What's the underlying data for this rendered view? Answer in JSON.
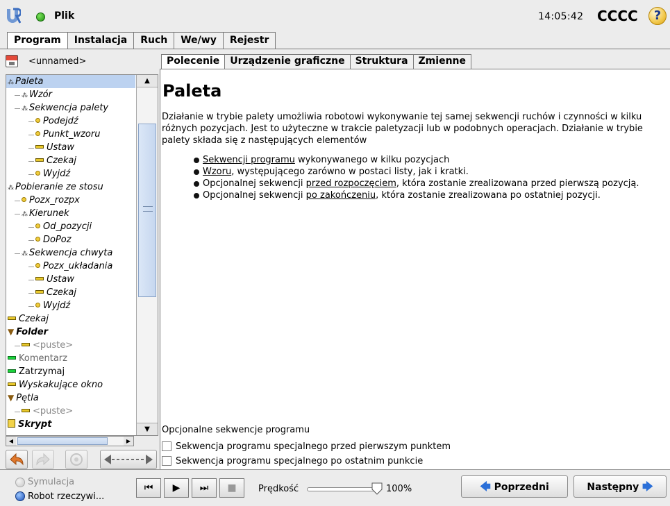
{
  "titlebar": {
    "file_menu": "Plik",
    "clock": "14:05:42",
    "robot_name": "CCCC",
    "help": "?"
  },
  "top_tabs": [
    {
      "label": "Program",
      "active": true
    },
    {
      "label": "Instalacja",
      "active": false
    },
    {
      "label": "Ruch",
      "active": false
    },
    {
      "label": "We/wy",
      "active": false
    },
    {
      "label": "Rejestr",
      "active": false
    }
  ],
  "left": {
    "program_name": "<unnamed>",
    "tree": [
      {
        "label": "Paleta",
        "icon": "cluster-icon",
        "depth": 0,
        "selected": true
      },
      {
        "label": "Wzór",
        "icon": "cluster-icon",
        "depth": 1
      },
      {
        "label": "Sekwencja palety",
        "icon": "cluster-icon",
        "depth": 1,
        "expandable": true
      },
      {
        "label": "Podejdź",
        "icon": "waypoint-icon",
        "depth": 2
      },
      {
        "label": "Punkt_wzoru",
        "icon": "waypoint-icon",
        "depth": 2
      },
      {
        "label": "Ustaw",
        "icon": "command-icon",
        "depth": 2
      },
      {
        "label": "Czekaj",
        "icon": "command-icon",
        "depth": 2
      },
      {
        "label": "Wyjdź",
        "icon": "waypoint-icon",
        "depth": 2
      },
      {
        "label": "Pobieranie ze stosu",
        "icon": "cluster-icon",
        "depth": 0
      },
      {
        "label": "Pozx_rozpx",
        "icon": "waypoint-icon",
        "depth": 1
      },
      {
        "label": "Kierunek",
        "icon": "cluster-icon",
        "depth": 1,
        "expandable": true
      },
      {
        "label": "Od_pozycji",
        "icon": "waypoint-icon",
        "depth": 2
      },
      {
        "label": "DoPoz",
        "icon": "waypoint-icon",
        "depth": 2
      },
      {
        "label": "Sekwencja chwyta",
        "icon": "cluster-icon",
        "depth": 1,
        "expandable": true
      },
      {
        "label": "Pozx_układania",
        "icon": "waypoint-icon",
        "depth": 2
      },
      {
        "label": "Ustaw",
        "icon": "command-icon",
        "depth": 2
      },
      {
        "label": "Czekaj",
        "icon": "command-icon",
        "depth": 2
      },
      {
        "label": "Wyjdź",
        "icon": "waypoint-icon",
        "depth": 2
      },
      {
        "label": "Czekaj",
        "icon": "command-icon",
        "depth": 0
      },
      {
        "label": "Folder",
        "icon": "folder-icon",
        "depth": 0,
        "bold": true
      },
      {
        "label": "<puste>",
        "icon": "command-icon",
        "depth": 1,
        "grey": true
      },
      {
        "label": "Komentarz",
        "icon": "comment-icon",
        "depth": 0,
        "dim": true
      },
      {
        "label": "Zatrzymaj",
        "icon": "stop-icon",
        "depth": 0,
        "plain": true
      },
      {
        "label": "Wyskakujące okno",
        "icon": "command-icon",
        "depth": 0
      },
      {
        "label": "Pętla",
        "icon": "folder-icon",
        "depth": 0
      },
      {
        "label": "<puste>",
        "icon": "command-icon",
        "depth": 1,
        "grey": true
      },
      {
        "label": "Skrypt",
        "icon": "script-icon",
        "depth": 0,
        "bold": true
      }
    ]
  },
  "sub_tabs": [
    {
      "label": "Polecenie",
      "active": true
    },
    {
      "label": "Urządzenie graficzne",
      "active": false
    },
    {
      "label": "Struktura",
      "active": false
    },
    {
      "label": "Zmienne",
      "active": false
    }
  ],
  "content": {
    "title": "Paleta",
    "description": "Działanie w trybie palety umożliwia robotowi wykonywanie tej samej sekwencji ruchów i czynności w kilku różnych pozycjach. Jest to użyteczne w trakcie paletyzacji lub w podobnych operacjach. Działanie w trybie palety składa się z następujących elementów",
    "bullets": [
      {
        "link": "Sekwencji programu",
        "rest": " wykonywanego w kilku pozycjach",
        "pre": ""
      },
      {
        "link": "Wzoru",
        "rest": ", występującego zarówno w postaci listy, jak i kratki.",
        "pre": ""
      },
      {
        "pre": "Opcjonalnej sekwencji ",
        "link": "przed rozpoczęciem",
        "rest": ", która zostanie zrealizowana przed pierwszą pozycją."
      },
      {
        "pre": "Opcjonalnej sekwencji ",
        "link": "po zakończeniu",
        "rest": ", która zostanie zrealizowana po ostatniej pozycji."
      }
    ],
    "optional_label": "Opcjonalne sekwencje programu",
    "checkbox_before": "Sekwencja programu specjalnego przed pierwszym punktem",
    "checkbox_after": "Sekwencja programu specjalnego po ostatnim punkcie"
  },
  "footer": {
    "simulation_label": "Symulacja",
    "real_robot_label": "Robot rzeczywi...",
    "speed_label": "Prędkość",
    "speed_value": "100%",
    "speed_fraction": 1.0,
    "prev_label": "Poprzedni",
    "next_label": "Następny"
  }
}
